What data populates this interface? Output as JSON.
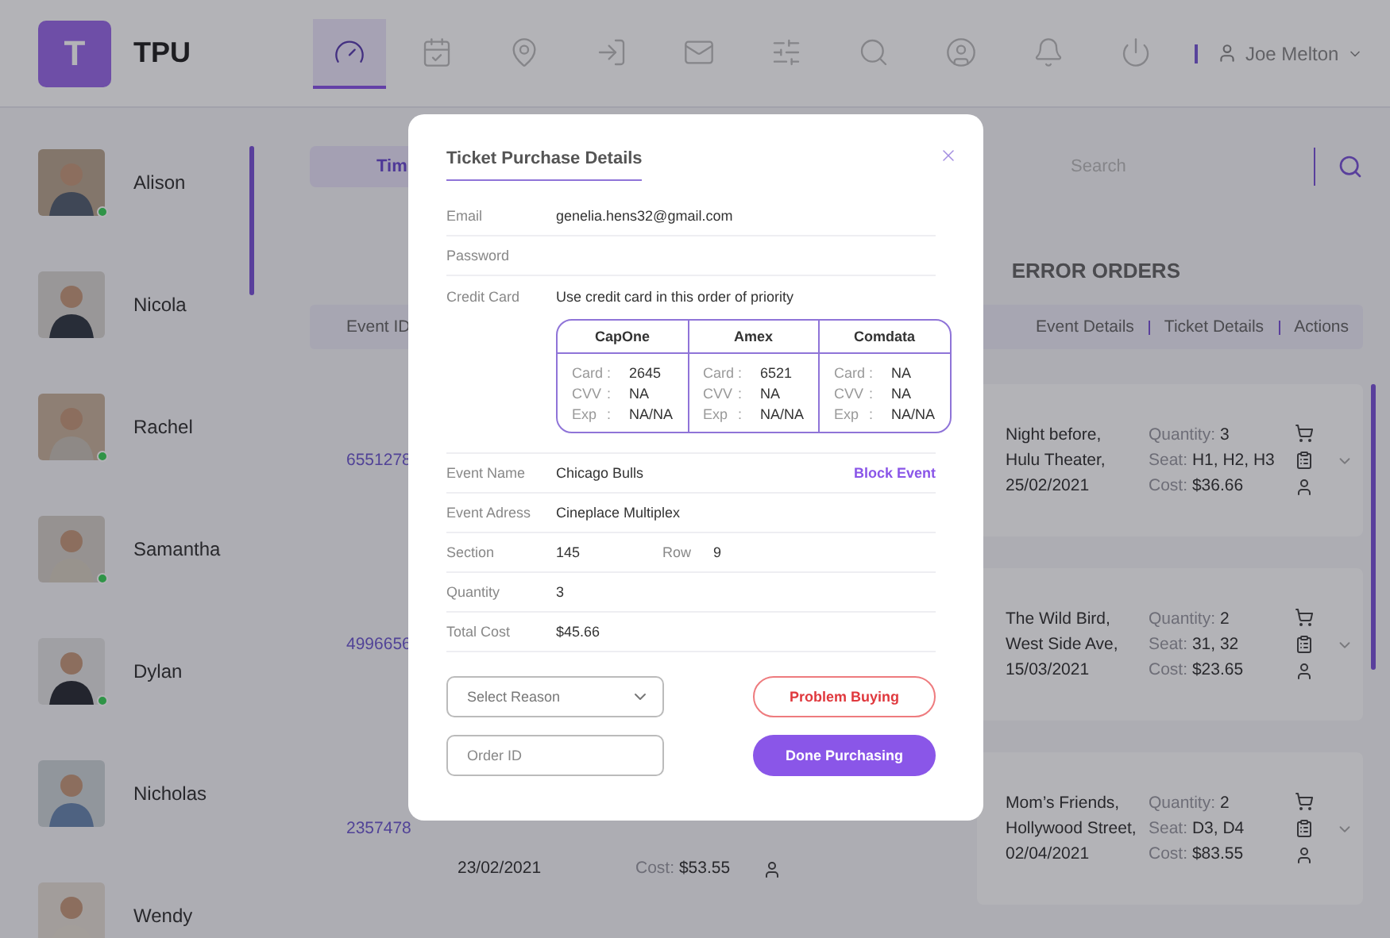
{
  "header": {
    "logo": "T",
    "app_name": "TPU",
    "nav": [
      {
        "selected": true
      },
      {
        "selected": false
      },
      {
        "selected": false
      },
      {
        "selected": false
      },
      {
        "selected": false
      },
      {
        "selected": false
      },
      {
        "selected": false
      },
      {
        "selected": false
      },
      {
        "selected": false
      },
      {
        "selected": false
      }
    ],
    "user": {
      "name": "Joe Melton"
    }
  },
  "sidebar": {
    "contacts": [
      {
        "name": "Alison",
        "online": true
      },
      {
        "name": "Nicola",
        "online": false
      },
      {
        "name": "Rachel",
        "online": true
      },
      {
        "name": "Samantha",
        "online": true
      },
      {
        "name": "Dylan",
        "online": true
      },
      {
        "name": "Nicholas",
        "online": false
      },
      {
        "name": "Wendy"
      }
    ]
  },
  "tabs": [
    {
      "label": "Tim",
      "selected": true
    }
  ],
  "search": {
    "placeholder": "Search"
  },
  "section_title": "ERROR ORDERS",
  "table": {
    "columns": [
      "Event ID",
      "Event Details",
      "Ticket Details",
      "Actions"
    ],
    "rows": [
      {
        "event_id": "6551278",
        "event": [
          "Night before,",
          "Hulu Theater,",
          "25/02/2021"
        ],
        "ticket": [
          {
            "label": "Quantity:",
            "value": "3"
          },
          {
            "label": "Seat:",
            "value": "H1, H2, H3"
          },
          {
            "label": "Cost:",
            "value": "$36.66"
          }
        ]
      },
      {
        "event_id": "4996656",
        "event": [
          "The Wild Bird,",
          "West Side Ave,",
          "15/03/2021"
        ],
        "ticket": [
          {
            "label": "Quantity:",
            "value": "2"
          },
          {
            "label": "Seat:",
            "value": "31, 32"
          },
          {
            "label": "Cost:",
            "value": "$23.65"
          }
        ]
      },
      {
        "event_id": "2357478",
        "left_card": {
          "event": "23/02/2021",
          "ticket": {
            "label": "Cost:",
            "value": "$53.55"
          }
        },
        "event": [
          "Mom’s Friends,",
          "Hollywood Street,",
          "02/04/2021"
        ],
        "ticket": [
          {
            "label": "Quantity:",
            "value": "2"
          },
          {
            "label": "Seat:",
            "value": "D3, D4"
          },
          {
            "label": "Cost:",
            "value": "$83.55"
          }
        ]
      }
    ]
  },
  "modal": {
    "title": "Ticket Purchase Details",
    "fields": [
      {
        "label": "Email",
        "value": "genelia.hens32@gmail.com"
      },
      {
        "label": "Password"
      }
    ],
    "credit_card": {
      "label": "Credit Card",
      "note": "Use credit card in this order of priority",
      "cards": [
        {
          "name": "CapOne",
          "rows": [
            {
              "label": "Card",
              "sep": ":",
              "value": "2645"
            },
            {
              "label": "CVV",
              "sep": ":",
              "value": "NA"
            },
            {
              "label": "Exp",
              "sep": ":",
              "value": "NA/NA"
            }
          ]
        },
        {
          "name": "Amex",
          "rows": [
            {
              "label": "Card",
              "sep": ":",
              "value": "6521"
            },
            {
              "label": "CVV",
              "sep": ":",
              "value": "NA"
            },
            {
              "label": "Exp",
              "sep": ":",
              "value": "NA/NA"
            }
          ]
        },
        {
          "name": "Comdata",
          "rows": [
            {
              "label": "Card",
              "sep": ":",
              "value": "NA"
            },
            {
              "label": "CVV",
              "sep": ":",
              "value": "NA"
            },
            {
              "label": "Exp",
              "sep": ":",
              "value": "NA/NA"
            }
          ]
        }
      ]
    },
    "details": [
      {
        "label": "Event Name",
        "value": "Chicago Bulls",
        "link": "Block Event"
      },
      {
        "label": "Event Adress",
        "value": "Cineplace Multiplex"
      },
      {
        "label": "Section",
        "value": "145",
        "extra": {
          "label": "Row",
          "value": "9"
        }
      },
      {
        "label": "Quantity",
        "value": "3"
      },
      {
        "label": "Total Cost",
        "value": "$45.66"
      }
    ],
    "select": {
      "placeholder": "Select Reason"
    },
    "order_input": {
      "placeholder": "Order ID"
    },
    "buttons": [
      {
        "label": "Problem Buying",
        "kind": "outline"
      },
      {
        "label": "Done Purchasing",
        "kind": "primary"
      }
    ]
  }
}
